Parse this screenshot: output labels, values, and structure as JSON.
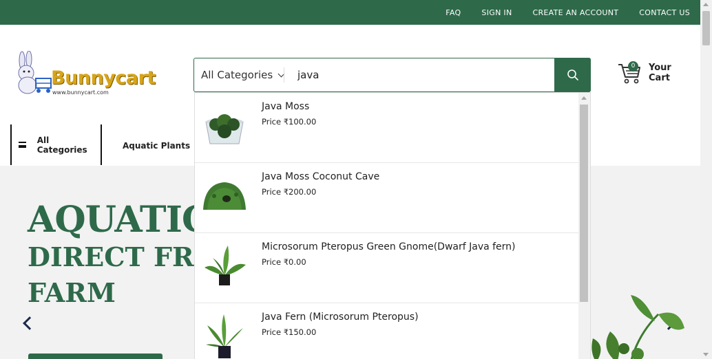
{
  "topbar": {
    "links": [
      "FAQ",
      "SIGN IN",
      "CREATE AN ACCOUNT",
      "CONTACT US"
    ]
  },
  "logo": {
    "brand": "Bunnycart",
    "url": "www.bunnycart.com"
  },
  "search": {
    "category": "All Categories",
    "value": "java",
    "icon": "search-icon"
  },
  "cart": {
    "count": "0",
    "label": "Your Cart",
    "icon": "cart-icon"
  },
  "nav": {
    "all_categories": "All Categories",
    "items": [
      "Aquatic Plants"
    ]
  },
  "hero": {
    "line1": "AQUATIC",
    "line2": "DIRECT FRO",
    "line3": "FARM"
  },
  "suggestions": [
    {
      "name": "Java Moss",
      "price": "Price ₹100.00"
    },
    {
      "name": "Java Moss Coconut Cave",
      "price": "Price ₹200.00"
    },
    {
      "name": "Microsorum Pteropus Green Gnome(Dwarf Java fern)",
      "price": "Price ₹0.00"
    },
    {
      "name": "Java Fern (Microsorum Pteropus)",
      "price": "Price ₹150.00"
    }
  ],
  "colors": {
    "brand_green": "#2e6a4a",
    "logo_gold": "#d7a51a"
  }
}
